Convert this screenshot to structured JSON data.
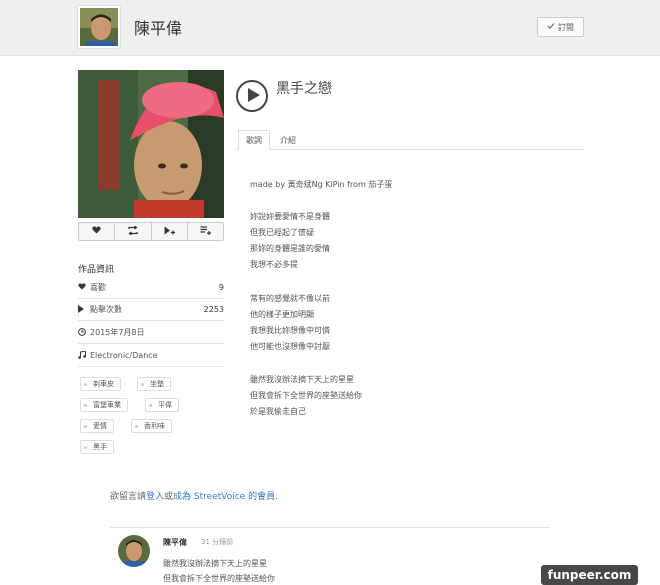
{
  "header": {
    "artist_name": "陳平偉",
    "subscribe_label": "訂閱"
  },
  "song": {
    "title": "黑手之戀"
  },
  "tabs": [
    {
      "label": "歌詞"
    },
    {
      "label": "介紹"
    }
  ],
  "lyrics": {
    "credit": "made by 黃奇斌Ng KiPin from 茄子蛋",
    "lines": [
      "妳說妳要愛情不是身體",
      "但我已經起了懷疑",
      "那妳的身體是誰的愛情",
      "我想不必多提",
      "常有的感覺就不像以前",
      "他的樣子更加明顯",
      "我想我比妳想像中可憐",
      "他可能也沒想像中討厭",
      "雖然我沒辦法摘下天上的星星",
      "但我會拆下全世界的座墊送給你",
      "於是我偷走自己"
    ]
  },
  "info": {
    "title": "作品資訊",
    "likes_label": "喜歡",
    "likes": "9",
    "plays_label": "點擊次數",
    "plays": "2253",
    "date": "2015年7月8日",
    "genre": "Electronic/Dance"
  },
  "tags": [
    "剃車皮",
    "坐墊",
    "富堡車業",
    "平偉",
    "愛情",
    "香利味",
    "黑手"
  ],
  "comment_prompt": {
    "prefix": "欲留言請",
    "login": "登入",
    "or": "或",
    "join": "成為 StreetVoice 的會員",
    "suffix": "."
  },
  "comment": {
    "user": "陳平偉",
    "time": "31 分鐘前",
    "lines": [
      "雖然我沒辦法摘下天上的星星",
      "但我會拆下全世界的座墊送給你"
    ]
  },
  "watermark": "funpeer.com",
  "icons": [
    "check-icon",
    "heart-icon",
    "repeat-icon",
    "play-next-icon",
    "add-to-list-icon",
    "play-icon",
    "clock-icon",
    "music-note-icon"
  ]
}
